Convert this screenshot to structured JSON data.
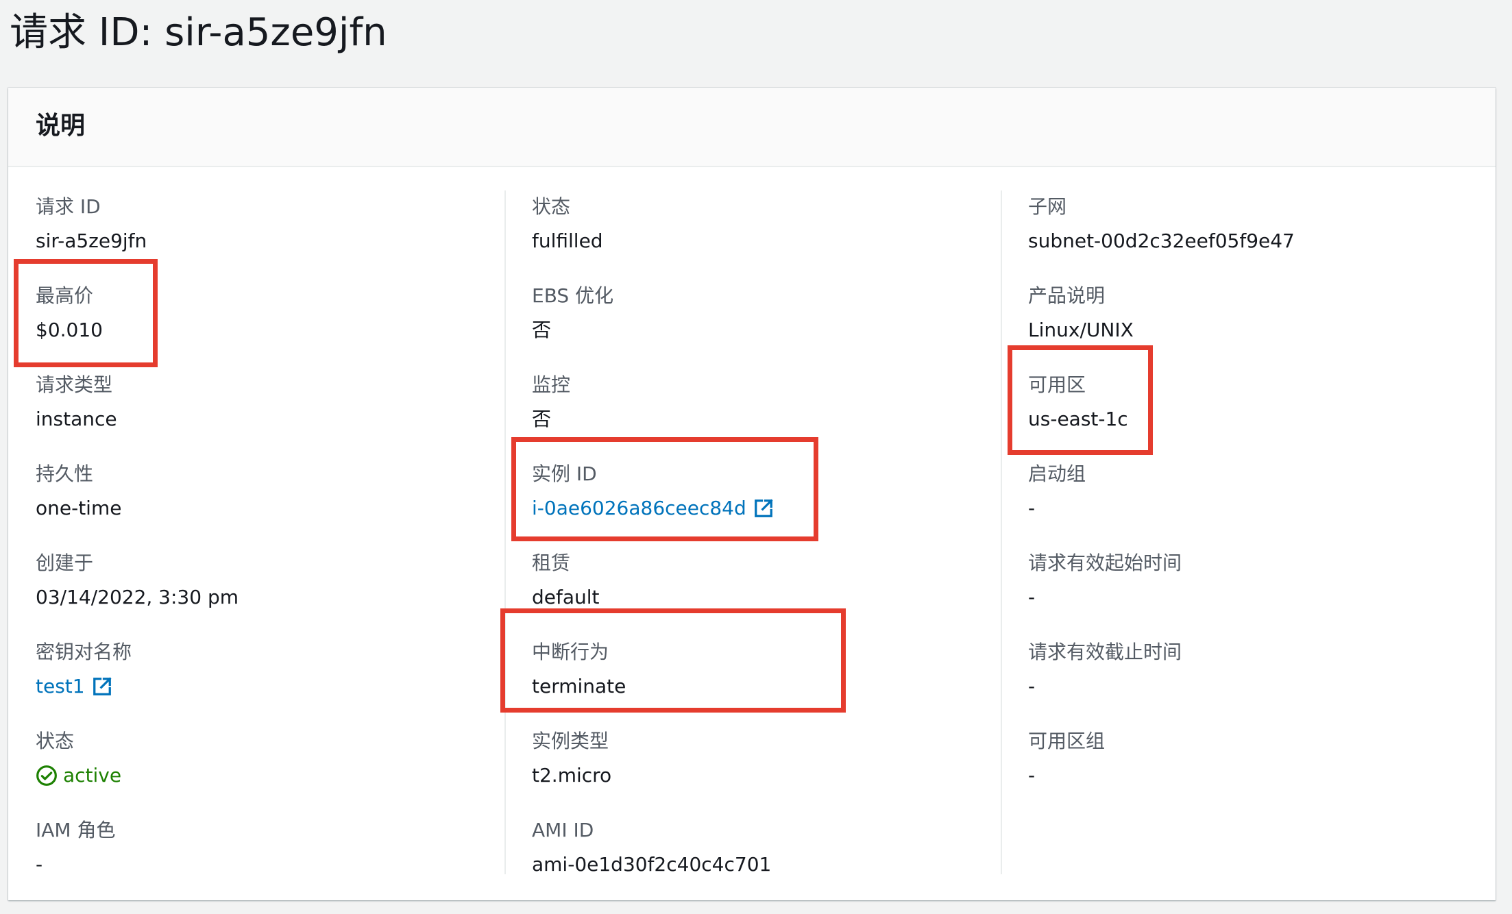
{
  "page": {
    "title": "请求 ID: sir-a5ze9jfn"
  },
  "panel": {
    "title": "说明"
  },
  "colors": {
    "link": "#0073bb",
    "success": "#1d8102",
    "highlight": "#e53c2e"
  },
  "col1": [
    {
      "label": "请求 ID",
      "value": "sir-a5ze9jfn"
    },
    {
      "label": "最高价",
      "value": "$0.010"
    },
    {
      "label": "请求类型",
      "value": "instance"
    },
    {
      "label": "持久性",
      "value": "one-time"
    },
    {
      "label": "创建于",
      "value": "03/14/2022, 3:30 pm"
    },
    {
      "label": "密钥对名称",
      "value": "test1",
      "link": true,
      "icon": "external-link-icon"
    },
    {
      "label": "状态",
      "value": "active",
      "status": "success",
      "icon": "check-circle-icon"
    },
    {
      "label": "IAM 角色",
      "value": "-"
    }
  ],
  "col2": [
    {
      "label": "状态",
      "value": "fulfilled"
    },
    {
      "label": "EBS 优化",
      "value": "否"
    },
    {
      "label": "监控",
      "value": "否"
    },
    {
      "label": "实例 ID",
      "value": "i-0ae6026a86ceec84d",
      "link": true,
      "icon": "external-link-icon"
    },
    {
      "label": "租赁",
      "value": "default"
    },
    {
      "label": "中断行为",
      "value": "terminate"
    },
    {
      "label": "实例类型",
      "value": "t2.micro"
    },
    {
      "label": "AMI ID",
      "value": "ami-0e1d30f2c40c4c701"
    }
  ],
  "col3": [
    {
      "label": "子网",
      "value": "subnet-00d2c32eef05f9e47"
    },
    {
      "label": "产品说明",
      "value": "Linux/UNIX"
    },
    {
      "label": "可用区",
      "value": "us-east-1c"
    },
    {
      "label": "启动组",
      "value": "-"
    },
    {
      "label": "请求有效起始时间",
      "value": "-"
    },
    {
      "label": "请求有效截止时间",
      "value": "-"
    },
    {
      "label": "可用区组",
      "value": "-"
    }
  ]
}
